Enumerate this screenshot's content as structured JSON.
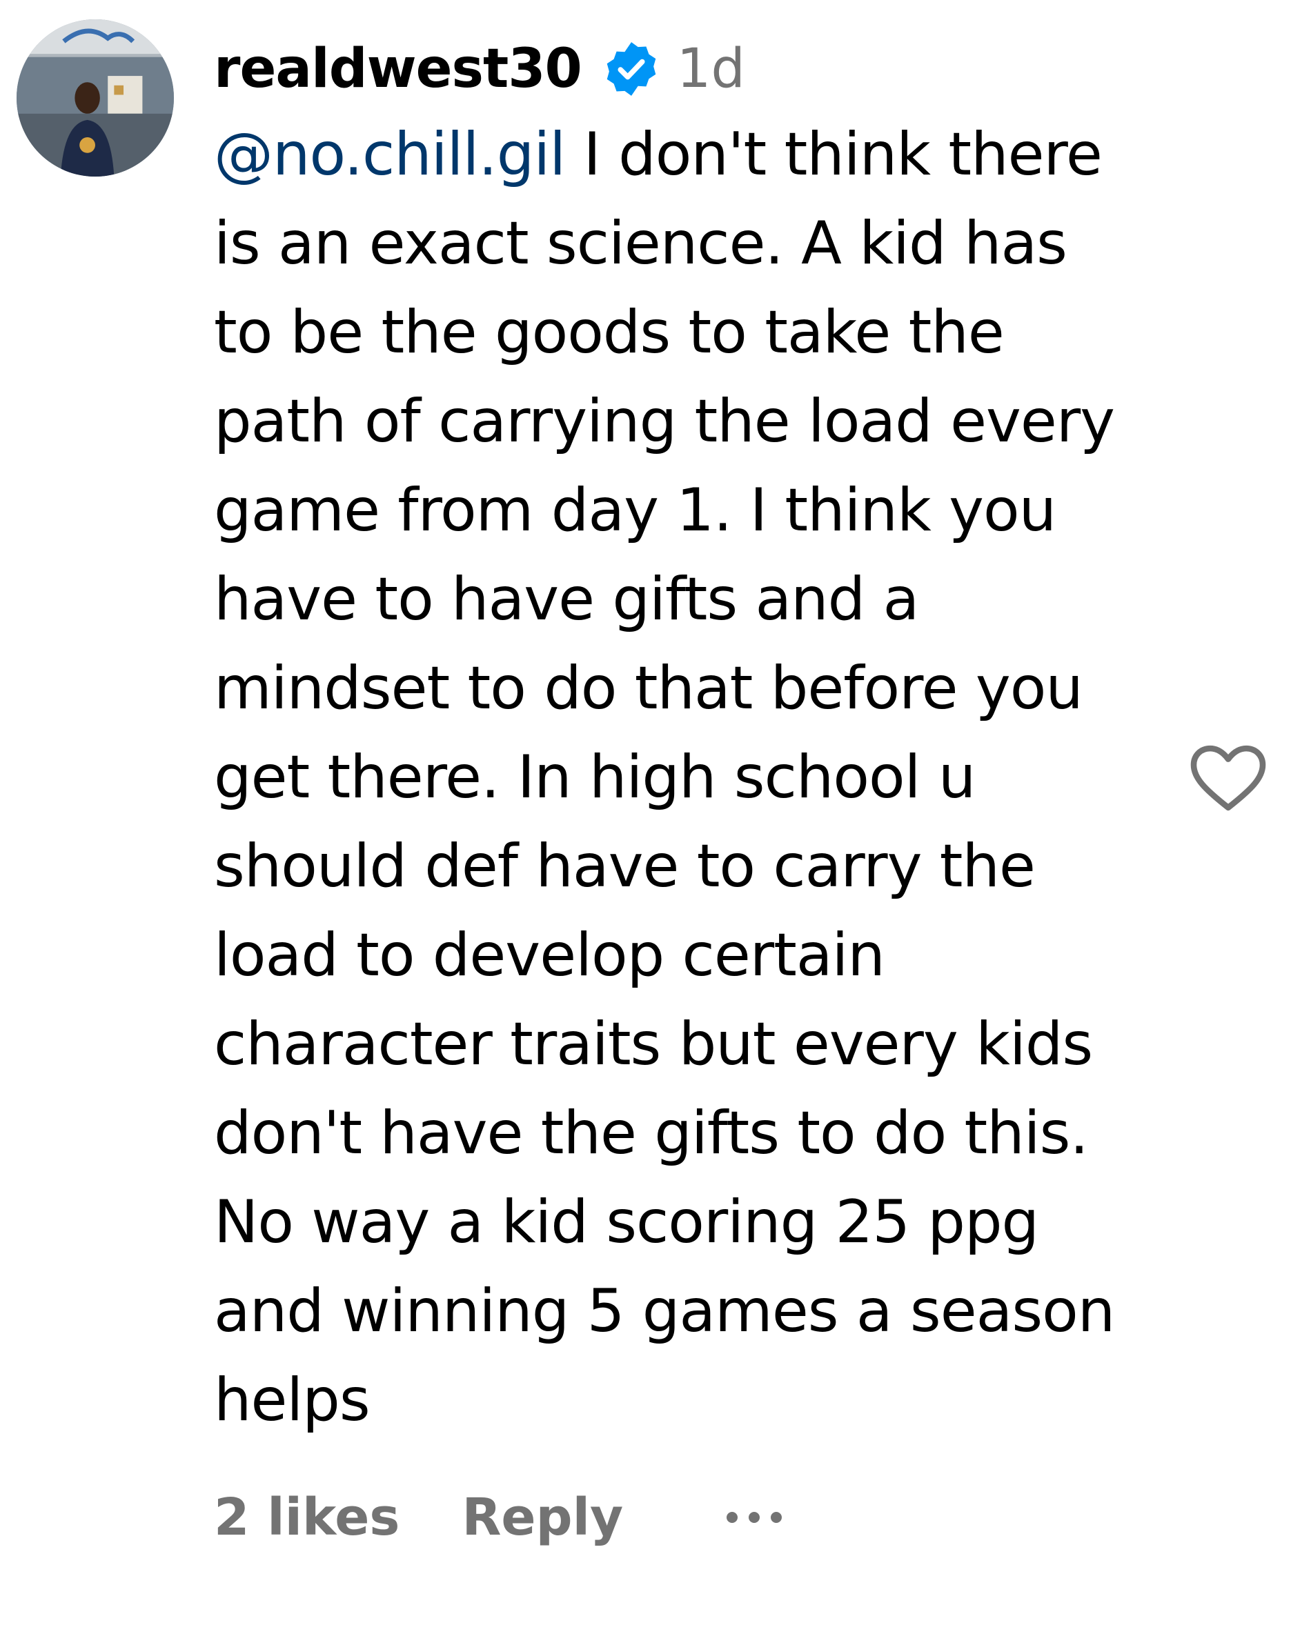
{
  "comment": {
    "username": "realdwest30",
    "verified": true,
    "time": "1d",
    "mention": "@no.chill.gil",
    "lines": [
      " I don't think there",
      "is an exact science. A kid has",
      "to be the goods to take the",
      "path of carrying the load every",
      "game from day 1. I think you",
      "have to have gifts and a",
      "mindset to do that before you",
      "get there. In high school u",
      "should def have to carry the",
      "load to develop certain",
      "character traits but every kids",
      "don't have the gifts to do this.",
      "No way a kid scoring 25 ppg",
      "and winning 5 games a season",
      "helps"
    ],
    "likes": "2 likes",
    "reply_label": "Reply",
    "like_icon": "heart-outline-icon",
    "more_icon": "more-options-icon"
  },
  "colors": {
    "text": "#000000",
    "secondary": "#737373",
    "mention": "#00376b",
    "verified": "#0095f6"
  }
}
